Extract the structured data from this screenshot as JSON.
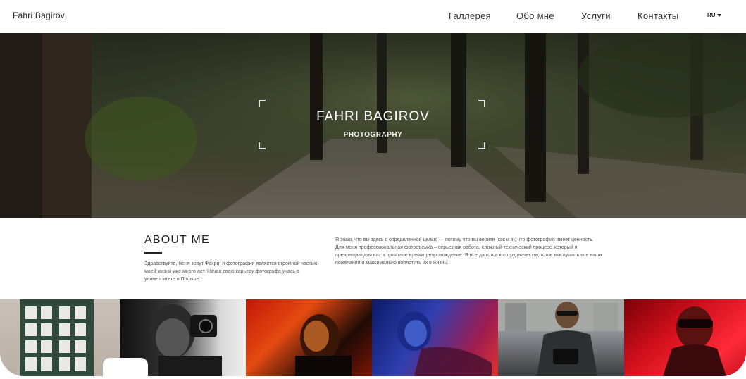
{
  "header": {
    "brand": "Fahri Bagirov",
    "nav": [
      "Галлерея",
      "Обо мне",
      "Услуги",
      "Контакты"
    ],
    "lang": "RU"
  },
  "hero": {
    "title": "FAHRI BAGIROV",
    "subtitle": "PHOTOGRAPHY"
  },
  "about": {
    "heading": "ABOUT ME",
    "left_text": "Здравствуйте, меня зовут Фахри, и фотография является огромной частью моей жизни уже много лет. Начал свою карьеру фотографа учась в университете в Польше.",
    "right_text": "Я знаю, что вы здесь с определенной целью — потому что вы верите (как и я), что фотография имеет ценность. Для меня профессиональная фотосъемка – серьезная работа, сложный технический процесс, который я превращаю для вас в приятное времяпрепровождение. Я всегда готов к сотрудничеству, готов выслушать все ваши пожелания и максимально воплотить их в жизнь."
  },
  "icons": {
    "lang_caret": "chevron-down-icon"
  }
}
